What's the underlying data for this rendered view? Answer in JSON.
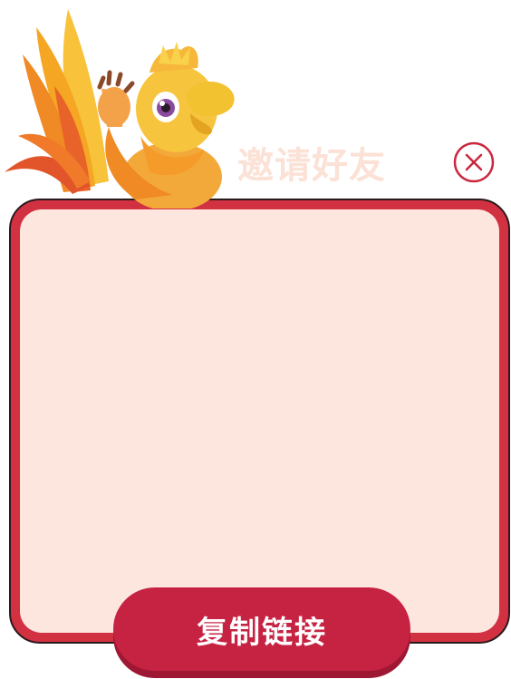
{
  "dialog": {
    "title": "邀请好友",
    "copy_button_label": "复制链接"
  },
  "icons": {
    "close": "close-x-circle-icon",
    "mascot": "phoenix-chick-mascot"
  },
  "colors": {
    "frame": "#d23142",
    "panel": "#fde6de",
    "title": "#fbe1d6",
    "button": "#c62343",
    "close": "#c9283e"
  }
}
